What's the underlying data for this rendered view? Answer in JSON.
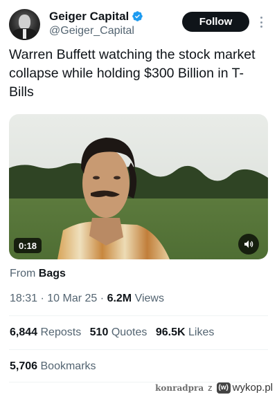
{
  "author": {
    "name": "Geiger Capital",
    "handle": "@Geiger_Capital",
    "verified_badge_icon": "verified-badge-icon",
    "verified_color": "#1d9bf0"
  },
  "follow_label": "Follow",
  "tweet": {
    "text": "Warren Buffett watching the stock market collapse while holding $300 Billion in T-Bills"
  },
  "video": {
    "duration": "0:18",
    "volume_icon": "volume-icon"
  },
  "source": {
    "prefix": "From",
    "name": "Bags"
  },
  "meta": {
    "time": "18:31",
    "date": "10 Mar 25",
    "views_count": "6.2M",
    "views_label": "Views"
  },
  "stats": {
    "reposts_count": "6,844",
    "reposts_label": "Reposts",
    "quotes_count": "510",
    "quotes_label": "Quotes",
    "likes_count": "96.5K",
    "likes_label": "Likes",
    "bookmarks_count": "5,706",
    "bookmarks_label": "Bookmarks"
  },
  "watermark": {
    "user": "konradpra",
    "z": "z",
    "site": "wykop.pl"
  }
}
